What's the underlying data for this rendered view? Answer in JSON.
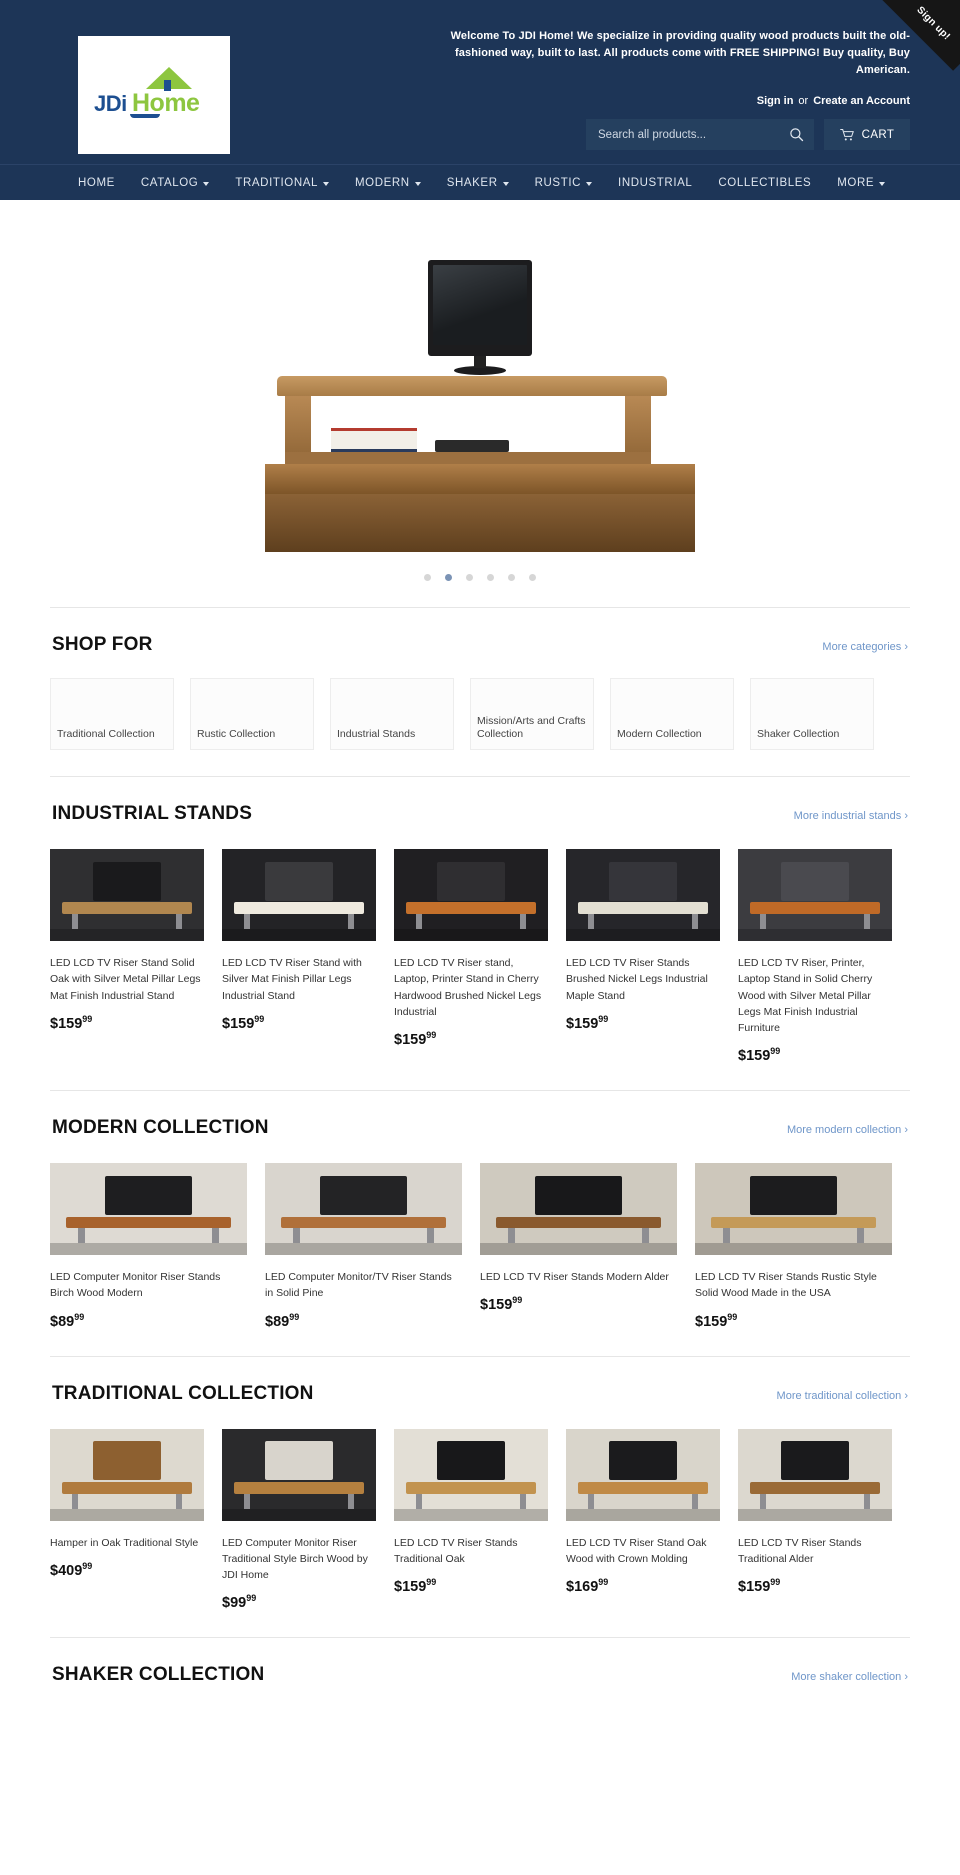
{
  "header": {
    "logo": {
      "text_left": "JDi",
      "text_right": "Home",
      "alt": "JDi Home"
    },
    "welcome": "Welcome To JDI Home! We specialize in providing quality  wood products built the old-fashioned way, built to last. All products come with FREE SHIPPING! Buy quality, Buy American.",
    "sign_in": "Sign in",
    "or": "or",
    "create_account": "Create an Account",
    "search_placeholder": "Search all products...",
    "search_value": "",
    "search_icon": "search-icon",
    "cart_label": "CART",
    "cart_icon": "cart-icon",
    "signup_ribbon": "Sign up!"
  },
  "nav": {
    "items": [
      {
        "label": "HOME",
        "has_caret": false
      },
      {
        "label": "CATALOG",
        "has_caret": true
      },
      {
        "label": "TRADITIONAL",
        "has_caret": true
      },
      {
        "label": "MODERN",
        "has_caret": true
      },
      {
        "label": "SHAKER",
        "has_caret": true
      },
      {
        "label": "RUSTIC",
        "has_caret": true
      },
      {
        "label": "INDUSTRIAL",
        "has_caret": false
      },
      {
        "label": "COLLECTIBLES",
        "has_caret": false
      },
      {
        "label": "MORE",
        "has_caret": true
      }
    ]
  },
  "hero": {
    "slides_count": 6,
    "active_slide": 2,
    "alt": "Oak TV riser stand with flat-screen television on a desk"
  },
  "shop_for": {
    "title": "SHOP FOR",
    "more_label": "More categories ›",
    "categories": [
      {
        "label": "Traditional Collection"
      },
      {
        "label": "Rustic Collection"
      },
      {
        "label": "Industrial Stands"
      },
      {
        "label": "Mission/Arts and Crafts Collection"
      },
      {
        "label": "Modern Collection"
      },
      {
        "label": "Shaker Collection"
      }
    ]
  },
  "sections": [
    {
      "title": "INDUSTRIAL STANDS",
      "more_label": "More industrial stands ›",
      "columns": 5,
      "products": [
        {
          "title": "LED LCD TV Riser Stand Solid Oak with Silver Metal Pillar Legs Mat Finish Industrial Stand",
          "price": "$159",
          "cents": "99",
          "img": "industrial-dark-room"
        },
        {
          "title": "LED LCD TV Riser Stand with Silver Mat Finish Pillar Legs Industrial Stand",
          "price": "$159",
          "cents": "99",
          "img": "white-shelf-dark"
        },
        {
          "title": "LED LCD TV Riser stand, Laptop, Printer Stand in Cherry Hardwood Brushed Nickel Legs Industrial",
          "price": "$159",
          "cents": "99",
          "img": "cherry-shelf-dark"
        },
        {
          "title": "LED LCD TV Riser Stands Brushed Nickel Legs Industrial Maple Stand",
          "price": "$159",
          "cents": "99",
          "img": "maple-shelf-dark"
        },
        {
          "title": "LED LCD TV Riser, Printer, Laptop Stand in Solid Cherry Wood with Silver Metal Pillar Legs Mat Finish Industrial Furniture",
          "price": "$159",
          "cents": "99",
          "img": "cherry-shelf-slate"
        }
      ]
    },
    {
      "title": "MODERN COLLECTION",
      "more_label": "More modern collection ›",
      "columns": 4,
      "products": [
        {
          "title": "LED Computer Monitor Riser Stands Birch Wood Modern",
          "price": "$89",
          "cents": "99",
          "img": "birch-monitor-riser"
        },
        {
          "title": "LED Computer Monitor/TV Riser Stands in Solid Pine",
          "price": "$89",
          "cents": "99",
          "img": "pine-monitor-riser"
        },
        {
          "title": "LED LCD TV Riser Stands Modern Alder",
          "price": "$159",
          "cents": "99",
          "img": "alder-tv-riser"
        },
        {
          "title": "LED LCD TV Riser Stands Rustic Style Solid Wood Made in the USA",
          "price": "$159",
          "cents": "99",
          "img": "rustic-tv-riser"
        }
      ]
    },
    {
      "title": "TRADITIONAL COLLECTION",
      "more_label": "More traditional collection ›",
      "columns": 5,
      "products": [
        {
          "title": "Hamper in Oak Traditional Style",
          "price": "$409",
          "cents": "99",
          "img": "oak-hamper"
        },
        {
          "title": "LED Computer Monitor Riser Traditional Style Birch Wood by JDI Home",
          "price": "$99",
          "cents": "99",
          "img": "birch-monitor-trad"
        },
        {
          "title": "LED LCD TV Riser Stands Traditional Oak",
          "price": "$159",
          "cents": "99",
          "img": "oak-tv-trad"
        },
        {
          "title": "LED LCD TV Riser Stand Oak Wood with Crown Molding",
          "price": "$169",
          "cents": "99",
          "img": "oak-crown-molding"
        },
        {
          "title": "LED LCD TV Riser Stands Traditional Alder",
          "price": "$159",
          "cents": "99",
          "img": "alder-tv-trad"
        }
      ]
    },
    {
      "title": "SHAKER COLLECTION",
      "more_label": "More shaker collection ›",
      "columns": 0,
      "products": []
    }
  ],
  "colors": {
    "header_bg": "#1d3557",
    "header_bg_alt": "#25405f",
    "link_blue": "#6f96c9",
    "logo_blue": "#1d4f91",
    "logo_green": "#8dc63f"
  }
}
